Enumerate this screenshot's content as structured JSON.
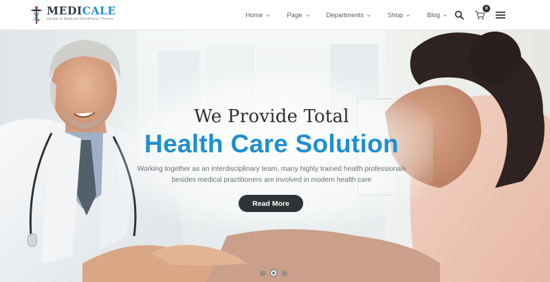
{
  "brand": {
    "name_part1": "MEDI",
    "name_part2": "CALE",
    "tagline": "Health & Medical WordPress Theme",
    "accent_color": "#1e8fcf"
  },
  "nav": {
    "items": [
      {
        "label": "Home",
        "icon": "chevron-down-icon"
      },
      {
        "label": "Page",
        "icon": "chevron-down-icon"
      },
      {
        "label": "Departments",
        "icon": "chevron-down-icon"
      },
      {
        "label": "Shop",
        "icon": "chevron-down-icon"
      },
      {
        "label": "Blog",
        "icon": "chevron-down-icon"
      }
    ]
  },
  "tools": {
    "search_icon": "search-icon",
    "cart_icon": "cart-icon",
    "cart_count": "0",
    "menu_icon": "hamburger-menu-icon"
  },
  "hero": {
    "headline_line1": "We Provide Total",
    "headline_line2": "Health Care Solution",
    "description_line1": "Working together as an interdisciplinary team, many highly trained health professionals",
    "description_line2": "besides medical practitioners are involved in modern health care",
    "cta_label": "Read More",
    "slides_count": 3,
    "active_slide": 2
  },
  "colors": {
    "headline_dark": "#2b2f33",
    "headline_blue": "#1e8fcf",
    "button_bg": "#2f3236"
  }
}
